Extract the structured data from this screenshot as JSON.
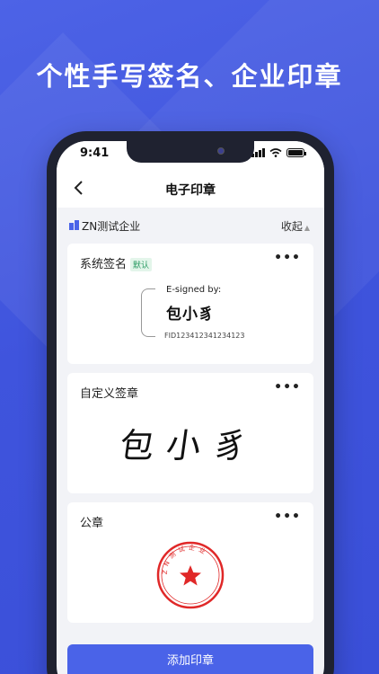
{
  "headline": "个性手写签名、企业印章",
  "status_bar": {
    "time": "9:41"
  },
  "nav": {
    "back_icon": "chevron-left-icon",
    "title": "电子印章"
  },
  "company": {
    "name": "ZN测试企业",
    "collapse_label": "收起"
  },
  "cards": [
    {
      "title": "系统签名",
      "badge": "默认",
      "more": "•••",
      "signed_by_label": "E-signed by:",
      "signer_name": "包小豸",
      "fid": "FID1234123412341​23"
    },
    {
      "title": "自定义签章",
      "more": "•••",
      "handwritten_text": "包小豸"
    },
    {
      "title": "公章",
      "more": "•••",
      "seal_text": "ZN测试企业"
    }
  ],
  "add_button_label": "添加印章",
  "colors": {
    "primary": "#4a63e8",
    "background": "#3f54dd",
    "seal": "#e02828"
  }
}
